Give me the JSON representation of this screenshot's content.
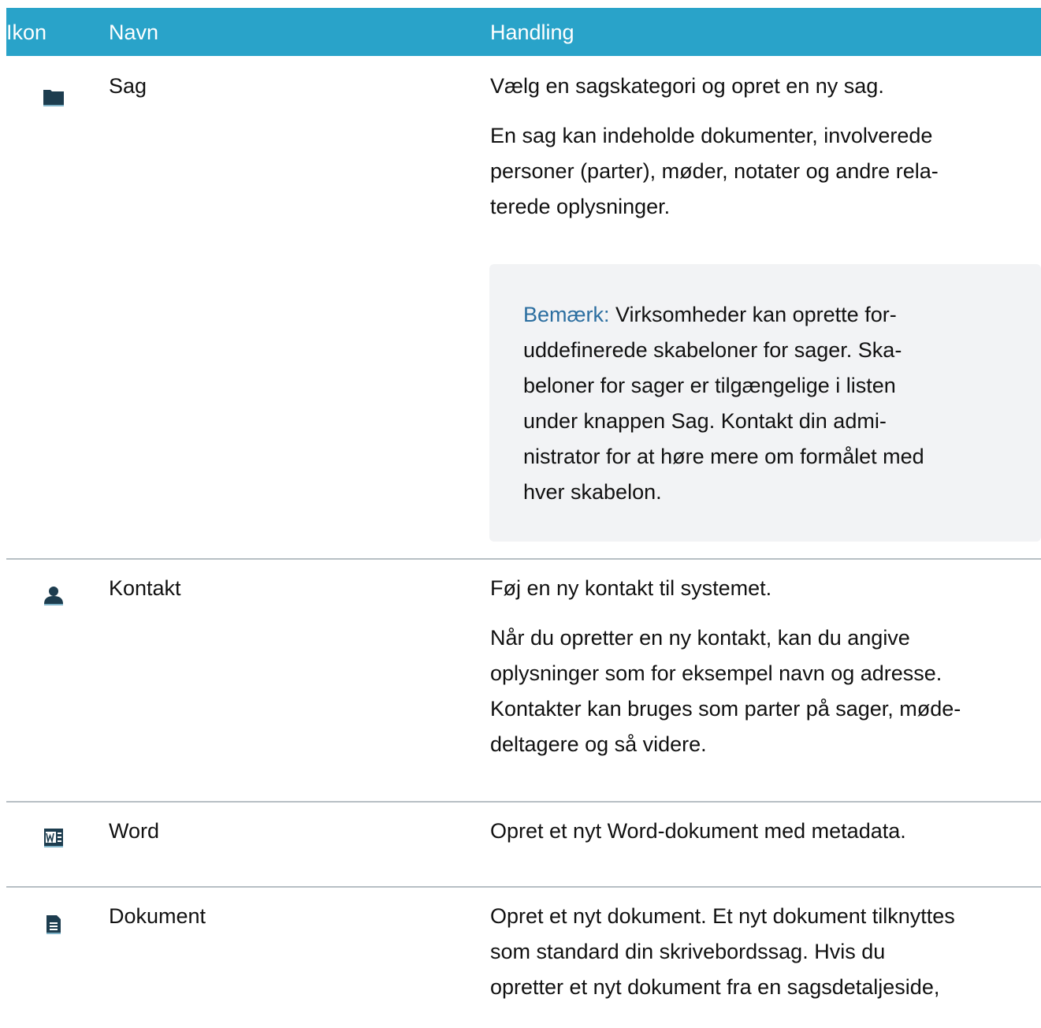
{
  "header": {
    "col_icon": "Ikon",
    "col_name": "Navn",
    "col_action": "Handling"
  },
  "rows": [
    {
      "icon": "folder-icon",
      "name": "Sag",
      "action_lines": [
        "Vælg en sagskategori og opret en ny sag.",
        "En sag kan indeholde dokumenter, involverede",
        "personer (parter), møder, notater og andre rela-",
        "terede oplysninger."
      ],
      "note": {
        "label": "Bemærk:",
        "line1_rest": " Virksomheder kan oprette for-",
        "line2": "uddefinerede skabeloner for sager. Ska-",
        "line3": "beloner for sager er tilgængelige i listen",
        "line4_pre": "under knappen ",
        "line4_bold": "Sag",
        "line4_post": ". Kontakt din admi-",
        "line5": "nistrator for at høre mere om formålet med",
        "line6": "hver skabelon."
      }
    },
    {
      "icon": "person-icon",
      "name": "Kontakt",
      "action_lines": [
        "Føj en ny kontakt til systemet.",
        "Når du opretter en ny kontakt, kan du angive",
        "oplysninger som for eksempel navn og adresse.",
        "Kontakter kan bruges som parter på sager, møde-",
        "deltagere og så videre."
      ]
    },
    {
      "icon": "word-document-icon",
      "name": "Word",
      "action_lines": [
        "Opret et nyt Word-dokument med metadata."
      ]
    },
    {
      "icon": "document-icon",
      "name": "Dokument",
      "action_lines": [
        "Opret et nyt dokument. Et nyt dokument tilknyttes",
        "som standard din skrivebordssag. Hvis du",
        "opretter et nyt dokument fra en sagsdetaljeside,"
      ]
    }
  ],
  "colors": {
    "header_bg": "#29a3c9",
    "note_bg": "#f2f3f5",
    "note_label": "#2b6ea0",
    "icon": "#1d3d4f"
  }
}
